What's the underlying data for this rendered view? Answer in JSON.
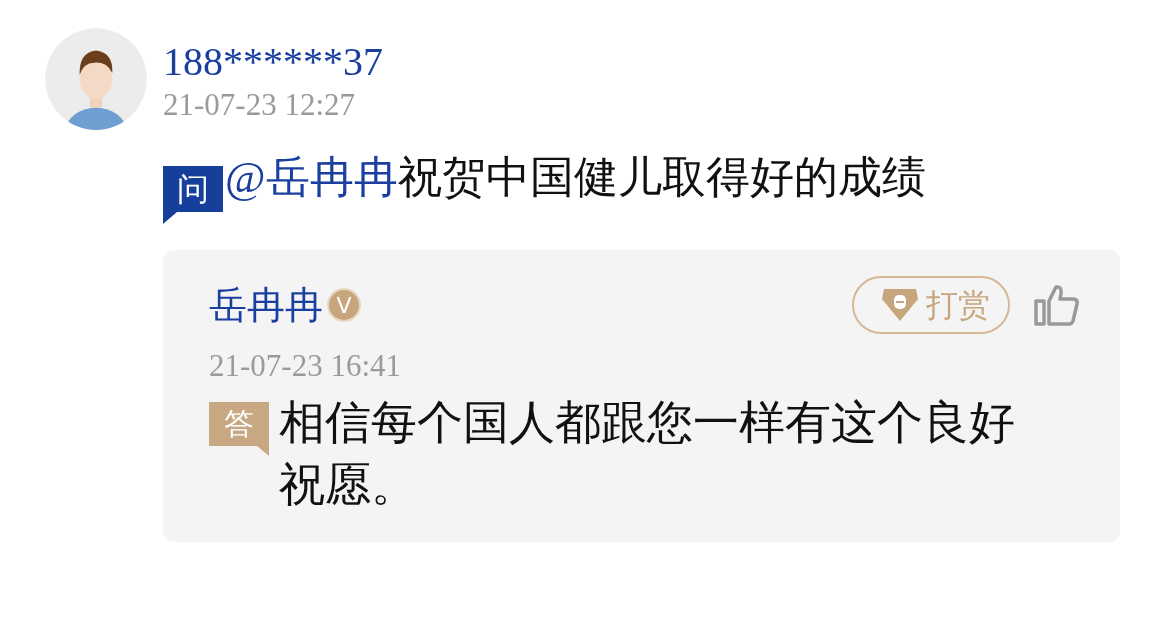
{
  "question": {
    "author": "188******37",
    "time": "21-07-23 12:27",
    "tag": "问",
    "mention": "@岳冉冉",
    "text": "祝贺中国健儿取得好的成绩"
  },
  "answer": {
    "author": "岳冉冉",
    "verified_badge": "V",
    "tip_button": "打赏",
    "time": "21-07-23 16:41",
    "tag": "答",
    "text": "相信每个国人都跟您一样有这个良好祝愿。"
  }
}
